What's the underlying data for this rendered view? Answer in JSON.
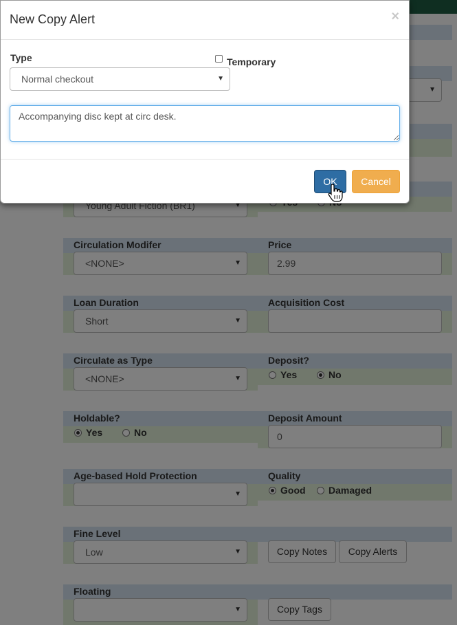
{
  "modal": {
    "title": "New Copy Alert",
    "close_glyph": "×",
    "type_label": "Type",
    "type_value": "Normal checkout",
    "temporary_label": "Temporary",
    "temporary_checked": false,
    "note": "Accompanying disc kept at circ desk.",
    "ok_label": "OK",
    "cancel_label": "Cancel"
  },
  "background": {
    "partial_shelving_value": "Young Adult Fiction (BR1)",
    "partial_yes": "Yes",
    "partial_no": "No",
    "circ_modifier": {
      "label": "Circulation Modifer",
      "value": "<NONE>"
    },
    "price": {
      "label": "Price",
      "value": "2.99"
    },
    "loan_duration": {
      "label": "Loan Duration",
      "value": "Short"
    },
    "acquisition_cost": {
      "label": "Acquisition Cost",
      "value": ""
    },
    "circulate_as_type": {
      "label": "Circulate as Type",
      "value": "<NONE>"
    },
    "deposit": {
      "label": "Deposit?",
      "yes": "Yes",
      "no": "No",
      "selected": "No"
    },
    "holdable": {
      "label": "Holdable?",
      "yes": "Yes",
      "no": "No",
      "selected": "Yes"
    },
    "deposit_amount": {
      "label": "Deposit Amount",
      "value": "0"
    },
    "age_hold_protection": {
      "label": "Age-based Hold Protection",
      "value": ""
    },
    "quality": {
      "label": "Quality",
      "good": "Good",
      "damaged": "Damaged",
      "selected": "Good"
    },
    "fine_level": {
      "label": "Fine Level",
      "value": "Low"
    },
    "copy_notes_button": "Copy Notes",
    "copy_alerts_button": "Copy Alerts",
    "floating": {
      "label": "Floating",
      "value": ""
    },
    "copy_tags_button": "Copy Tags"
  },
  "colors": {
    "primary_button": "#2e6da4",
    "warning_button": "#f0ad4e",
    "header_row": "#d4e3f1",
    "field_row": "#e2f0d9",
    "top_bar": "#1f5c43"
  }
}
